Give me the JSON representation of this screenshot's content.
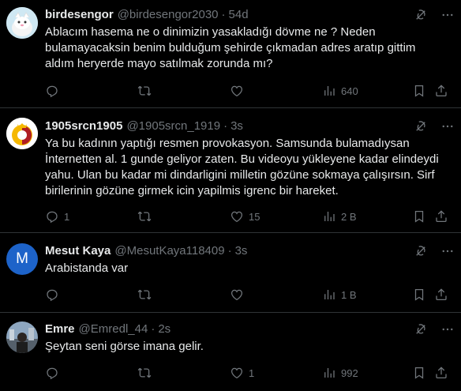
{
  "tweets": [
    {
      "name": "birdesengor",
      "handle": "@birdesengor2030",
      "time": "54d",
      "text": "Ablacım hasema ne o dinimizin yasakladığı dövme ne ? Neden\nbulamayacaksin benim bulduğum şehirde çıkmadan adres aratıp gittim\naldım heryerde mayo satılmak zorunda mı?",
      "replies": "",
      "retweets": "",
      "likes": "",
      "views": "640"
    },
    {
      "name": "1905srcn1905",
      "handle": "@1905srcn_1919",
      "time": "3s",
      "text": "Ya bu kadının yaptığı resmen provokasyon. Samsunda bulamadıysan\nİnternetten al. 1 gunde geliyor zaten. Bu videoyu yükleyene kadar elindeydi\nyahu. Ulan bu kadar mi dindarligini milletin gözüne sokmaya çalışırsın. Sirf\nbirilerinin gözüne girmek icin yapilmis igrenc bir hareket.",
      "replies": "1",
      "retweets": "",
      "likes": "15",
      "views": "2 B"
    },
    {
      "name": "Mesut Kaya",
      "handle": "@MesutKaya118409",
      "time": "3s",
      "avatar_letter": "M",
      "text": "Arabistanda var",
      "replies": "",
      "retweets": "",
      "likes": "",
      "views": "1 B"
    },
    {
      "name": "Emre",
      "handle": "@Emredl_44",
      "time": "2s",
      "text": "Şeytan seni görse imana gelir.",
      "replies": "",
      "retweets": "",
      "likes": "1",
      "views": "992"
    }
  ],
  "separator": "·",
  "colors": {
    "background": "#000000",
    "text": "#e7e9ea",
    "muted": "#71767b",
    "border": "#2f3336",
    "galatasaray_red": "#b01e23",
    "galatasaray_yellow": "#f5b800",
    "mesut_avatar": "#1d63c9"
  }
}
